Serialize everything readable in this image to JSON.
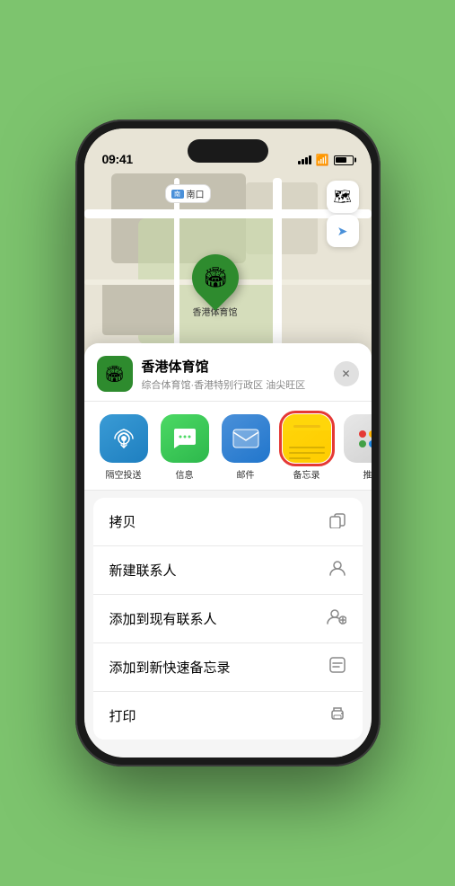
{
  "status_bar": {
    "time": "09:41",
    "location_arrow": "▶"
  },
  "map": {
    "location_label": "南口",
    "controls": {
      "map_icon": "🗺",
      "location_icon": "➤"
    }
  },
  "pin": {
    "label": "香港体育馆"
  },
  "sheet": {
    "venue_name": "香港体育馆",
    "venue_sub": "综合体育馆·香港特别行政区 油尖旺区",
    "close_label": "✕"
  },
  "share_apps": [
    {
      "id": "airdrop",
      "label": "隔空投送",
      "icon": "📡"
    },
    {
      "id": "messages",
      "label": "信息",
      "icon": "💬"
    },
    {
      "id": "mail",
      "label": "邮件",
      "icon": "✉"
    },
    {
      "id": "notes",
      "label": "备忘录",
      "icon": "📝",
      "selected": true
    },
    {
      "id": "more",
      "label": "推",
      "icon": "···"
    }
  ],
  "actions": [
    {
      "id": "copy",
      "label": "拷贝",
      "icon": "⎘"
    },
    {
      "id": "new-contact",
      "label": "新建联系人",
      "icon": "👤"
    },
    {
      "id": "add-existing",
      "label": "添加到现有联系人",
      "icon": "👤+"
    },
    {
      "id": "add-notes",
      "label": "添加到新快速备忘录",
      "icon": "⊞"
    },
    {
      "id": "print",
      "label": "打印",
      "icon": "🖨"
    }
  ]
}
